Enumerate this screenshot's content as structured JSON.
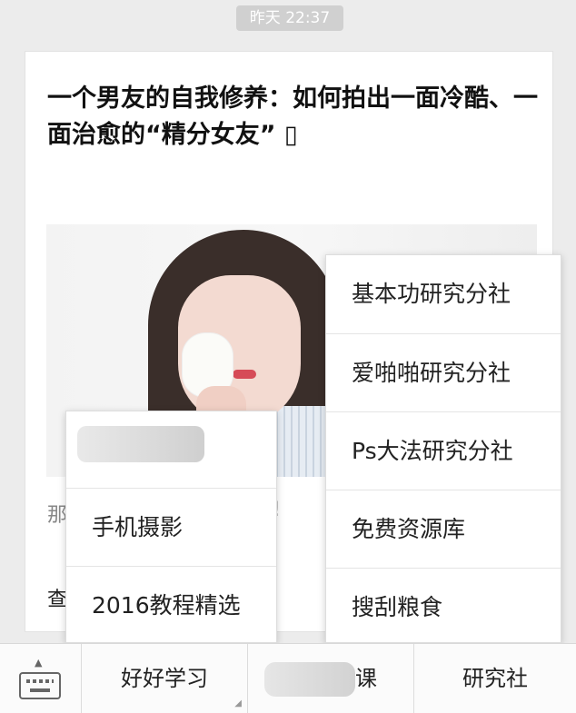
{
  "timestamp": "昨天 22:37",
  "article": {
    "title": "一个男友的自我修养：如何拍出一面冷酷、一面治愈的“精分女友” ▯",
    "summary_stub_left": "那",
    "summary_stub_right": "!",
    "read_more_stub": "查"
  },
  "popup_left": {
    "items": [
      "手机摄影",
      "2016教程精选"
    ]
  },
  "popup_right": {
    "items": [
      "基本功研究分社",
      "爱啪啪研究分社",
      "Ps大法研究分社",
      "免费资源库",
      "搜刮粮食"
    ]
  },
  "bottom_bar": {
    "tabs": [
      "好好学习",
      "课",
      "研究社"
    ]
  }
}
